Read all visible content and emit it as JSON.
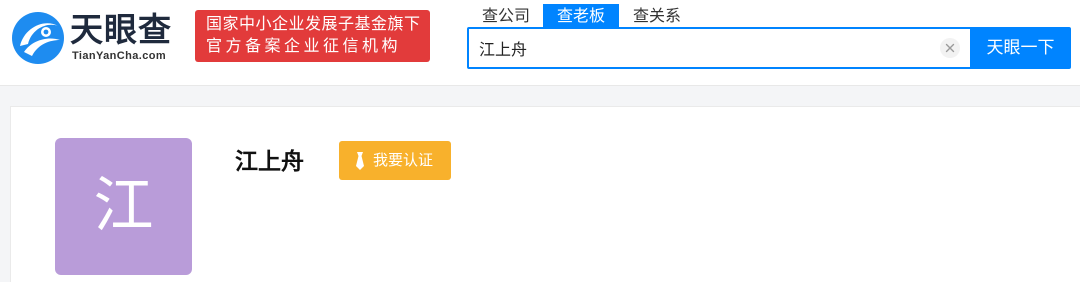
{
  "brand": {
    "name": "天眼查",
    "domain": "TianYanCha.com",
    "logo_icon": "eye-swirl-logo",
    "color": "#0084ff"
  },
  "fund_badge": {
    "line1": "国家中小企业发展子基金旗下",
    "line2": "官方备案企业征信机构",
    "color": "#e23b3b"
  },
  "search_tabs": [
    {
      "label": "查公司",
      "active": false
    },
    {
      "label": "查老板",
      "active": true
    },
    {
      "label": "查关系",
      "active": false
    }
  ],
  "search": {
    "value": "江上舟",
    "clear_icon": "close-icon",
    "button_label": "天眼一下"
  },
  "profile": {
    "avatar_text": "江",
    "avatar_color": "#b99cd9",
    "name": "江上舟",
    "verify_label": "我要认证",
    "verify_icon": "tie-icon",
    "verify_color": "#f8b12c"
  }
}
